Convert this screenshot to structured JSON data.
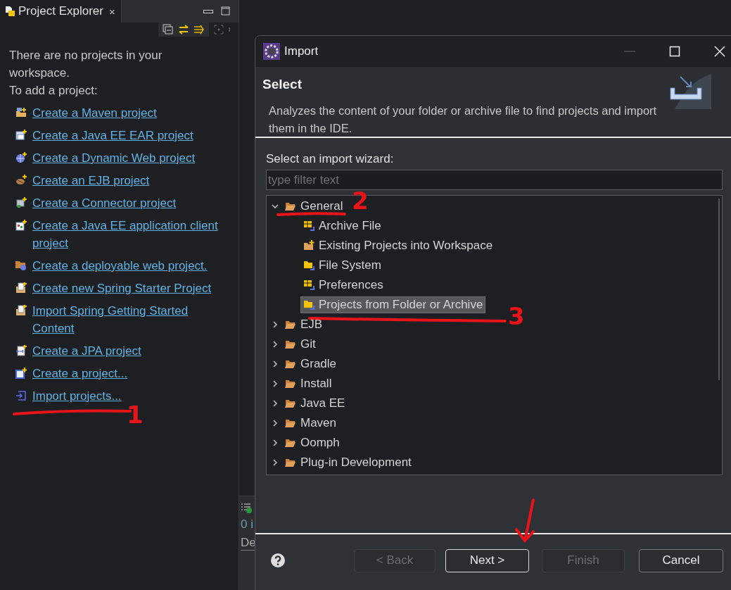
{
  "explorer": {
    "tab": {
      "title": "Project Explorer",
      "close": "×"
    },
    "message": [
      "There are no projects in your workspace.",
      "To add a project:"
    ],
    "links": [
      {
        "label": "Create a Maven project"
      },
      {
        "label": "Create a Java EE EAR project"
      },
      {
        "label": "Create a Dynamic Web project"
      },
      {
        "label": "Create an EJB project"
      },
      {
        "label": "Create a Connector project"
      },
      {
        "label": "Create a Java EE application client project"
      },
      {
        "label": "Create a deployable web project."
      },
      {
        "label": "Create new Spring Starter Project"
      },
      {
        "label": "Import Spring Getting Started Content"
      },
      {
        "label": "Create a JPA project"
      },
      {
        "label": "Create a project..."
      },
      {
        "label": "Import projects..."
      }
    ]
  },
  "background_view": {
    "status": "0 i",
    "column": "De"
  },
  "dialog": {
    "title": "Import",
    "heading": "Select",
    "description": "Analyzes the content of your folder or archive file to find projects and import them in the IDE.",
    "filter_label": "Select an import wizard:",
    "filter": {
      "placeholder": "type filter text"
    },
    "tree": [
      {
        "label": "General",
        "expanded": true,
        "selected": false,
        "children": [
          {
            "label": "Archive File",
            "selected": false
          },
          {
            "label": "Existing Projects into Workspace",
            "selected": false
          },
          {
            "label": "File System",
            "selected": false
          },
          {
            "label": "Preferences",
            "selected": false
          },
          {
            "label": "Projects from Folder or Archive",
            "selected": true
          }
        ]
      },
      {
        "label": "EJB",
        "expanded": false,
        "selected": false
      },
      {
        "label": "Git",
        "expanded": false,
        "selected": false
      },
      {
        "label": "Gradle",
        "expanded": false,
        "selected": false
      },
      {
        "label": "Install",
        "expanded": false,
        "selected": false
      },
      {
        "label": "Java EE",
        "expanded": false,
        "selected": false
      },
      {
        "label": "Maven",
        "expanded": false,
        "selected": false
      },
      {
        "label": "Oomph",
        "expanded": false,
        "selected": false
      },
      {
        "label": "Plug-in Development",
        "expanded": false,
        "selected": false
      }
    ],
    "buttons": [
      {
        "label": "< Back",
        "disabled": true,
        "default": false
      },
      {
        "label": "Next >",
        "disabled": false,
        "default": true
      },
      {
        "label": "Finish",
        "disabled": true,
        "default": false
      },
      {
        "label": "Cancel",
        "disabled": false,
        "default": false
      }
    ]
  },
  "annotations": [
    {
      "label": "1"
    },
    {
      "label": "2"
    },
    {
      "label": "3"
    }
  ]
}
